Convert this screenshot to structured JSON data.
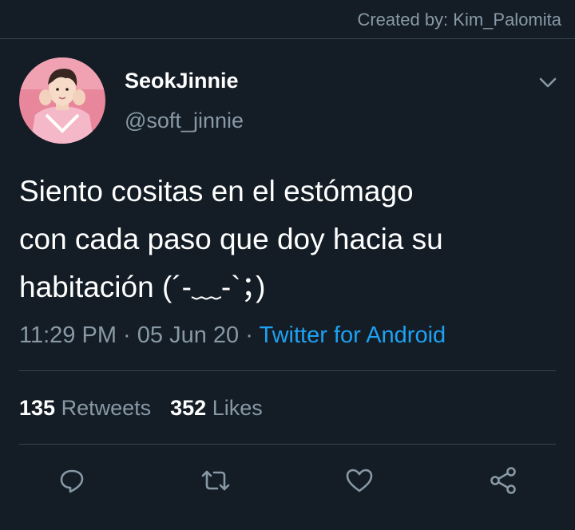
{
  "watermark": {
    "credit": "Created by: Kim_Palomita"
  },
  "author": {
    "display_name": "SeokJinnie",
    "handle": "@soft_jinnie",
    "avatar": "profile-photo-pink-background"
  },
  "tweet": {
    "text": "Siento cositas en el estómago\ncon cada paso que doy hacia su\nhabitación (´-﹏-`；)",
    "time": "11:29 PM",
    "separator": "·",
    "date": "05 Jun 20",
    "source": "Twitter for Android"
  },
  "stats": {
    "retweets_count": "135",
    "retweets_label": "Retweets",
    "likes_count": "352",
    "likes_label": "Likes"
  },
  "actions": {
    "reply": "reply-icon",
    "retweet": "retweet-icon",
    "like": "heart-icon",
    "share": "share-icon"
  },
  "colors": {
    "background": "#141d26",
    "secondary_text": "#8899a6",
    "link": "#1da1f2",
    "divider": "#38444d"
  }
}
